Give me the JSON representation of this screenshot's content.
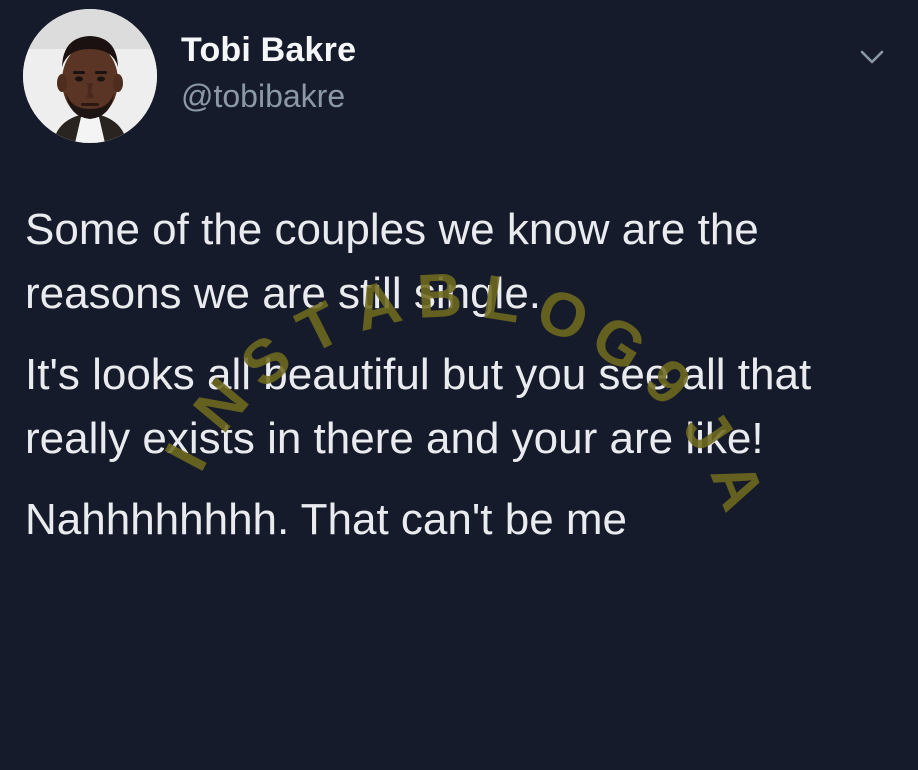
{
  "tweet": {
    "display_name": "Tobi Bakre",
    "handle": "@tobibakre",
    "paragraphs": [
      "Some of the couples we know are the reasons we are still single.",
      "It's looks all beautiful but you see all that really exists in there and your are like!",
      "Nahhhhhhhh. That can't be me"
    ]
  },
  "icons": {
    "menu": "chevron-down-icon",
    "avatar": "profile-photo"
  },
  "watermark": {
    "text": "INSTABLOG9JA",
    "color": "#6f6a1e"
  },
  "colors": {
    "background": "#161b2b",
    "text": "#e9ebee",
    "secondary": "#8b98a5"
  }
}
